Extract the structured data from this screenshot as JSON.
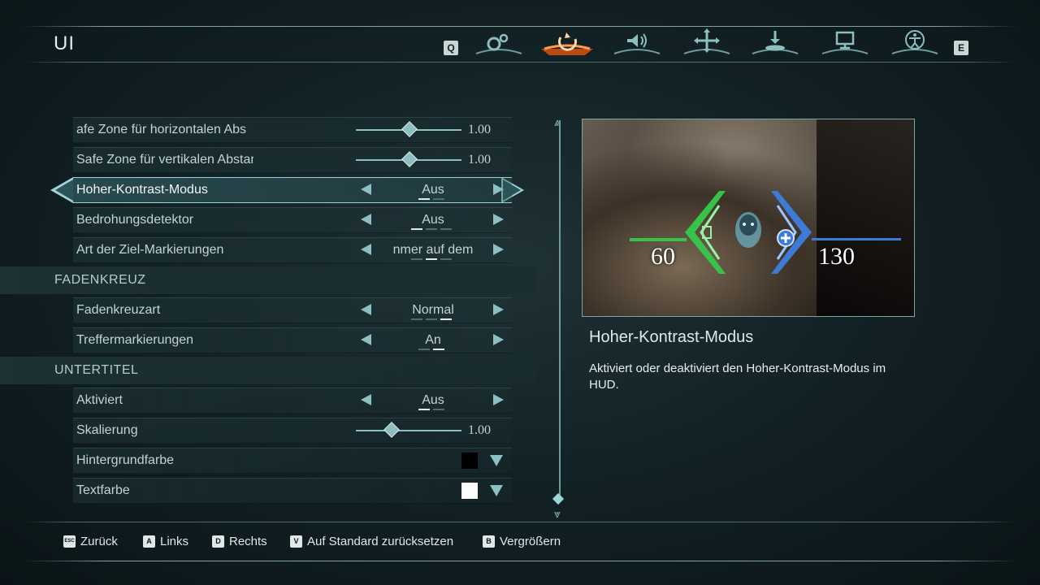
{
  "header": {
    "title": "UI",
    "left_key": "Q",
    "right_key": "E",
    "tabs": [
      {
        "icon": "gears-icon",
        "active": false
      },
      {
        "icon": "ui-spiral-icon",
        "active": true
      },
      {
        "icon": "speaker-icon",
        "active": false
      },
      {
        "icon": "move-cross-icon",
        "active": false
      },
      {
        "icon": "download-tray-icon",
        "active": false
      },
      {
        "icon": "monitor-icon",
        "active": false
      },
      {
        "icon": "accessibility-icon",
        "active": false
      }
    ]
  },
  "settings": {
    "safe_h": {
      "label": "afe Zone für horizontalen Abs",
      "value": "1.00",
      "level": 0.5
    },
    "safe_v": {
      "label": "Safe Zone für vertikalen Abstar",
      "value": "1.00",
      "level": 0.5
    },
    "high_contrast": {
      "label": "Hoher-Kontrast-Modus",
      "value": "Aus"
    },
    "threat": {
      "label": "Bedrohungsdetektor",
      "value": "Aus"
    },
    "target_marks": {
      "label": "Art der Ziel-Markierungen",
      "value": "nmer auf dem"
    },
    "section_crosshair": "FADENKREUZ",
    "crosshair_type": {
      "label": "Fadenkreuzart",
      "value": "Normal"
    },
    "hit_markers": {
      "label": "Treffermarkierungen",
      "value": "An"
    },
    "section_subtitles": "UNTERTITEL",
    "sub_enabled": {
      "label": "Aktiviert",
      "value": "Aus"
    },
    "sub_scale": {
      "label": "Skalierung",
      "value": "1.00",
      "level": 0.33
    },
    "bg_color": {
      "label": "Hintergrundfarbe",
      "swatch": "#000000"
    },
    "text_color": {
      "label": "Textfarbe",
      "swatch": "#ffffff"
    }
  },
  "preview": {
    "hud_left": "60",
    "hud_right": "130",
    "title": "Hoher-Kontrast-Modus",
    "description": "Aktiviert oder deaktiviert den Hoher-Kontrast-Modus im HUD."
  },
  "footer": {
    "hints": [
      {
        "key": "ESC",
        "label": "Zurück"
      },
      {
        "key": "A",
        "label": "Links"
      },
      {
        "key": "D",
        "label": "Rechts"
      },
      {
        "key": "V",
        "label": "Auf Standard zurücksetzen"
      },
      {
        "key": "B",
        "label": "Vergrößern"
      }
    ]
  },
  "colors": {
    "accent": "#9fd3d6",
    "green": "#37c24a",
    "blue": "#3d7bd6",
    "active_tab": "#e5702a"
  }
}
